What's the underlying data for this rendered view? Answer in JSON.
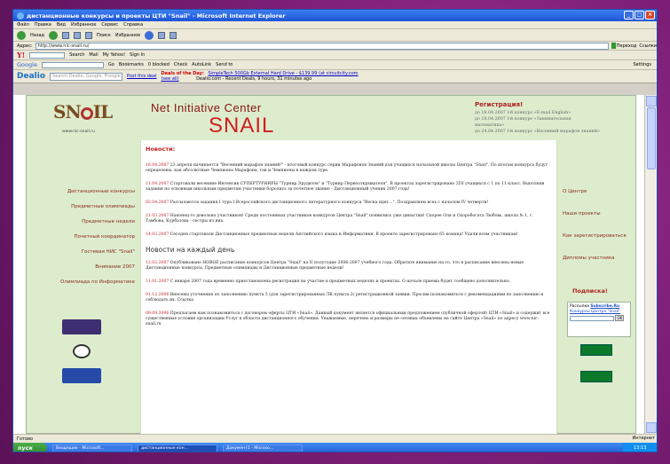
{
  "window": {
    "title": "дистанционные конкурсы и проекты ЦТИ \"Snail\" - Microsoft Internet Explorer"
  },
  "menu": [
    "Файл",
    "Правка",
    "Вид",
    "Избранное",
    "Сервис",
    "Справка"
  ],
  "toolbar": {
    "back": "Назад",
    "search": "Поиск",
    "favorites": "Избранное"
  },
  "address": {
    "label": "Адрес:",
    "url": "http://www.nic-snail.ru/",
    "go": "Переход",
    "links": "Ссылки"
  },
  "yahoo": {
    "logo": "Y!",
    "search": "Search",
    "mail": "Mail",
    "myyahoo": "My Yahoo!",
    "signin": "Sign In"
  },
  "google": {
    "logo": "Google",
    "go": "Go",
    "bookmarks": "Bookmarks",
    "blocked": "0 blocked",
    "check": "Check",
    "autolink": "AutoLink",
    "sendto": "Send to",
    "settings": "Settings"
  },
  "dealio": {
    "logo": "Dealio",
    "search_placeholder": "Search Dealio, Google, Froogle",
    "post_deal": "Post this deal",
    "deals_label": "Deals of the Day:",
    "deals_link": "(see all)",
    "deal1": "SimpleTech 500Gb External Hard Drive - $139.99 (at circuitcity.com",
    "deal2": "Dealio.com - Recent Deals, 9 hours, 31 minutes ago"
  },
  "site": {
    "logo_url": "www.nic-snail.ru",
    "net_center": "Net Initiative Center",
    "snail": "SNAIL",
    "reg_title": "Регистрация!",
    "reg_lines": [
      "до 18.04.2007 I-й конкурс «E-mail English»",
      "до 18.04.2007 I-й конкурс «Занимательная",
      "математика»",
      "до 24.04.2007 I-й конкурс «Весенний марафон знаний»"
    ]
  },
  "left_nav": [
    "Дистанционные конкурсы",
    "Предметные олимпиады",
    "Предметные недели",
    "Почетный координатор",
    "Гостевая НИС \"Snail\"",
    "Внимание 2007",
    "Олимпиада по Информатике"
  ],
  "right_nav": [
    "О Центре",
    "Наши проекты",
    "Как зарегистрироваться",
    "Дипломы участника"
  ],
  "news_title": "Новости:",
  "news_daily_title": "Новости на каждый день",
  "news": [
    {
      "date": "16.04.2007",
      "text": " 23 апреля начинается \"Весенний марафон знаний!\" - итоговый конкурс серии Марафонов Знаний для учащихся начальной школы Центра \"Snail\". По итогам конкурса будут определены, как абсолютные Чемпионы Марафона, так и Чемпионы в каждом туре."
    },
    {
      "date": "11.04.2007",
      "text": " Стартовали весенние Интенсив СУПЕРТУРНИРЫ \"Турнир Эрудитов\" и \"Турнир Первооткрывателя\". В проектах зарегистрировано 350 учащихся с 1 по 11 класс. Выполнив задания по основным школьным предметам участники боролись за почетное звание - Дистанционный ученик 2007 года!"
    },
    {
      "date": "02.04.2007",
      "text": " Рассылаются задания I тура I Всероссийского дистанционного литературного конкурса \"Весна идет...\". Поздравляем всех с началом IV четверти!"
    },
    {
      "date": "21.03.2007",
      "text": " Наконец-то довольно участников! Среди постоянных участников конкурсов Центра \"Snail\" появились уже династии! Скорее Оля и Скоробогата Любовь, школа № 1, г. Тамбова, Курбатова - сестры из них."
    },
    {
      "date": "14.03.2007",
      "text": " Сегодня стартовали Дистанционные предметные недели Английского языка и Информатики. В проекте зарегистрировано 65 команд! Удачи всем участникам!"
    }
  ],
  "news_daily": [
    {
      "date": "12.02.2007",
      "text": " Опубликовано НОВОЕ расписание конкурсов Центра \"Snail\" на II полугодие 2006-2007 учебного года. Обратите внимание на то, что в расписание внесены новые Дистанционные конкурсы, Предметные олимпиады и Дистанционные предметные недели!"
    },
    {
      "date": "11.01.2007",
      "text": " С января 2007 года временно приостановлена регистрация на участие в предметных неделях и проектах. О начале приема будет сообщено дополнительно."
    },
    {
      "date": "01.12.2006",
      "text": " Внесены уточнения по заполнению пункта 5 (для зарегистрированных ЛК пункта 2) регистрационной заявки. Просим познакомиться с рекомендациями по заполнению и соблюдать их. Ссылка"
    },
    {
      "date": "09.09.2006",
      "text": " Предлагаем вам познакомиться с договором оферты ЦТИ «Snail». Данный документ является официальным предложением (публичной офертой) ЦТИ «Snail» и содержит все существенные условия организации Услуг в области дистанционного обучения. Уважаемые, перечень и размеры не сетевых объявлены на сайте Центра «Snail» по адресу www.nic-snail.ru"
    }
  ],
  "subscribe": {
    "title": "Подписка!",
    "label": "Рассылки",
    "service": "Subscribe.Ru",
    "link": "Конкурсы Центра \"Snail\"",
    "ok": "OK"
  },
  "status": {
    "left": "Готово",
    "zone": "Интернет"
  },
  "taskbar": {
    "start": "пуск",
    "tasks": [
      "Входящие - Microsoft...",
      "дистанционные кон...",
      "Документ1 - Microso..."
    ],
    "clock": "13:13"
  }
}
